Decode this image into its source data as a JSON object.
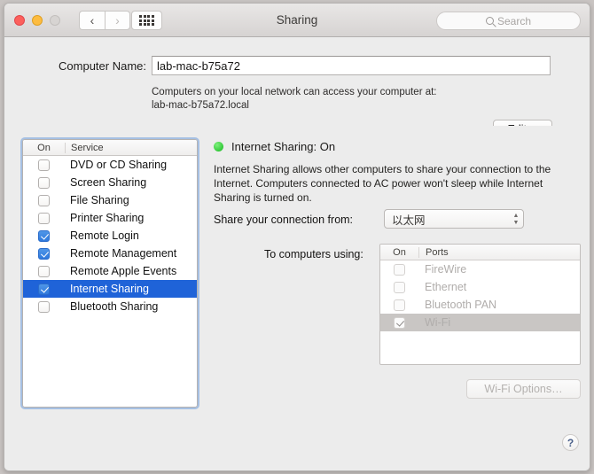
{
  "window": {
    "title": "Sharing",
    "traffic": {
      "close": "close-button",
      "minimize": "minimize-button",
      "zoom": "zoom-button"
    },
    "nav": {
      "back": "‹",
      "forward": "›"
    },
    "search": {
      "placeholder": "Search",
      "value": ""
    }
  },
  "computer_name": {
    "label": "Computer Name:",
    "value": "lab-mac-b75a72",
    "placeholder": "",
    "hint_line1": "Computers on your local network can access your computer at:",
    "hint_line2": "lab-mac-b75a72.local",
    "edit_label": "Edit…"
  },
  "services": {
    "columns": {
      "on": "On",
      "name": "Service"
    },
    "items": [
      {
        "name": "DVD or CD Sharing",
        "checked": false,
        "selected": false
      },
      {
        "name": "Screen Sharing",
        "checked": false,
        "selected": false
      },
      {
        "name": "File Sharing",
        "checked": false,
        "selected": false
      },
      {
        "name": "Printer Sharing",
        "checked": false,
        "selected": false
      },
      {
        "name": "Remote Login",
        "checked": true,
        "selected": false
      },
      {
        "name": "Remote Management",
        "checked": true,
        "selected": false
      },
      {
        "name": "Remote Apple Events",
        "checked": false,
        "selected": false
      },
      {
        "name": "Internet Sharing",
        "checked": true,
        "selected": true
      },
      {
        "name": "Bluetooth Sharing",
        "checked": false,
        "selected": false
      }
    ]
  },
  "detail": {
    "status_text": "Internet Sharing: On",
    "status_color": "#33c93a",
    "description": "Internet Sharing allows other computers to share your connection to the Internet. Computers connected to AC power won't sleep while Internet Sharing is turned on.",
    "share_from_label": "Share your connection from:",
    "share_from_value": "以太网",
    "to_computers_label": "To computers using:",
    "ports": {
      "columns": {
        "on": "On",
        "name": "Ports"
      },
      "items": [
        {
          "name": "FireWire",
          "checked": false,
          "highlighted": false
        },
        {
          "name": "Ethernet",
          "checked": false,
          "highlighted": false
        },
        {
          "name": "Bluetooth PAN",
          "checked": false,
          "highlighted": false
        },
        {
          "name": "Wi-Fi",
          "checked": true,
          "highlighted": true
        }
      ]
    },
    "wifi_options_label": "Wi-Fi Options…",
    "help_label": "?"
  },
  "accent": "#1f63d8"
}
